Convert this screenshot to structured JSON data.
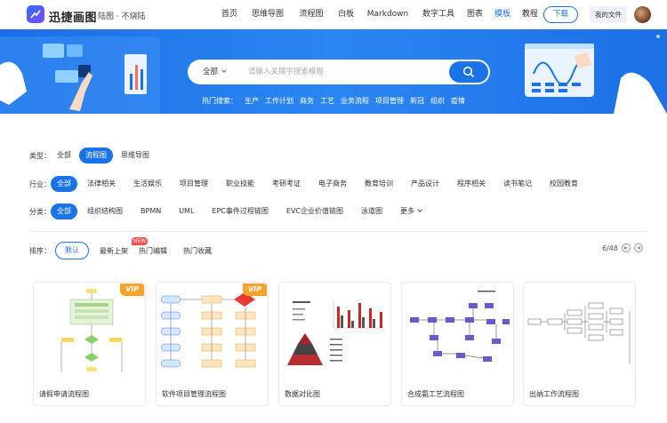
{
  "header": {
    "brand": "迅捷画图",
    "slogan": "陆图 · 不烧陆",
    "nav": [
      "首页",
      "思维导图",
      "流程图",
      "白板",
      "Markdown",
      "数字工具",
      "图表",
      "模板",
      "教程"
    ],
    "nav_active": "模板",
    "download_label": "下载",
    "myfiles_label": "我的文件"
  },
  "banner": {
    "search_scope": "全部",
    "search_placeholder": "请输入关键字搜索模板",
    "hot_label": "热门搜索：",
    "hot_tags": [
      "生产",
      "工作计划",
      "商务",
      "工艺",
      "业务流程",
      "项目管理",
      "新冠",
      "组织",
      "疫情"
    ]
  },
  "filters": {
    "type": {
      "label": "类型：",
      "options": [
        "全部",
        "流程图",
        "思维导图"
      ],
      "active": "流程图"
    },
    "industry": {
      "label": "行业：",
      "options": [
        "全部",
        "法律相关",
        "生活娱乐",
        "项目管理",
        "职业技能",
        "考研考证",
        "电子商务",
        "教育培训",
        "产品设计",
        "程序相关",
        "读书笔记",
        "校园教育"
      ],
      "active": "全部"
    },
    "category": {
      "label": "分类：",
      "options": [
        "全部",
        "组织结构图",
        "BPMN",
        "UML",
        "EPC事件过程链图",
        "EVC企业价值链图",
        "泳道图",
        "更多"
      ],
      "active": "全部"
    }
  },
  "sort": {
    "label": "排序：",
    "options": [
      "默认",
      "最新上架",
      "热门编辑",
      "热门收藏"
    ],
    "active": "默认",
    "new_badge": "NEW",
    "page_indicator": "6/48"
  },
  "templates": [
    {
      "title": "请假申请流程图",
      "vip": "VIP"
    },
    {
      "title": "软件项目管理流程图",
      "vip": "VIP"
    },
    {
      "title": "数据对比图",
      "vip": ""
    },
    {
      "title": "合成氨工艺流程图",
      "vip": ""
    },
    {
      "title": "出纳工作流程图",
      "vip": ""
    }
  ],
  "colors": {
    "accent": "#1a73e8",
    "banner": "#2a86f2",
    "vip": "#f7a32b",
    "new": "#ff4d4f"
  }
}
